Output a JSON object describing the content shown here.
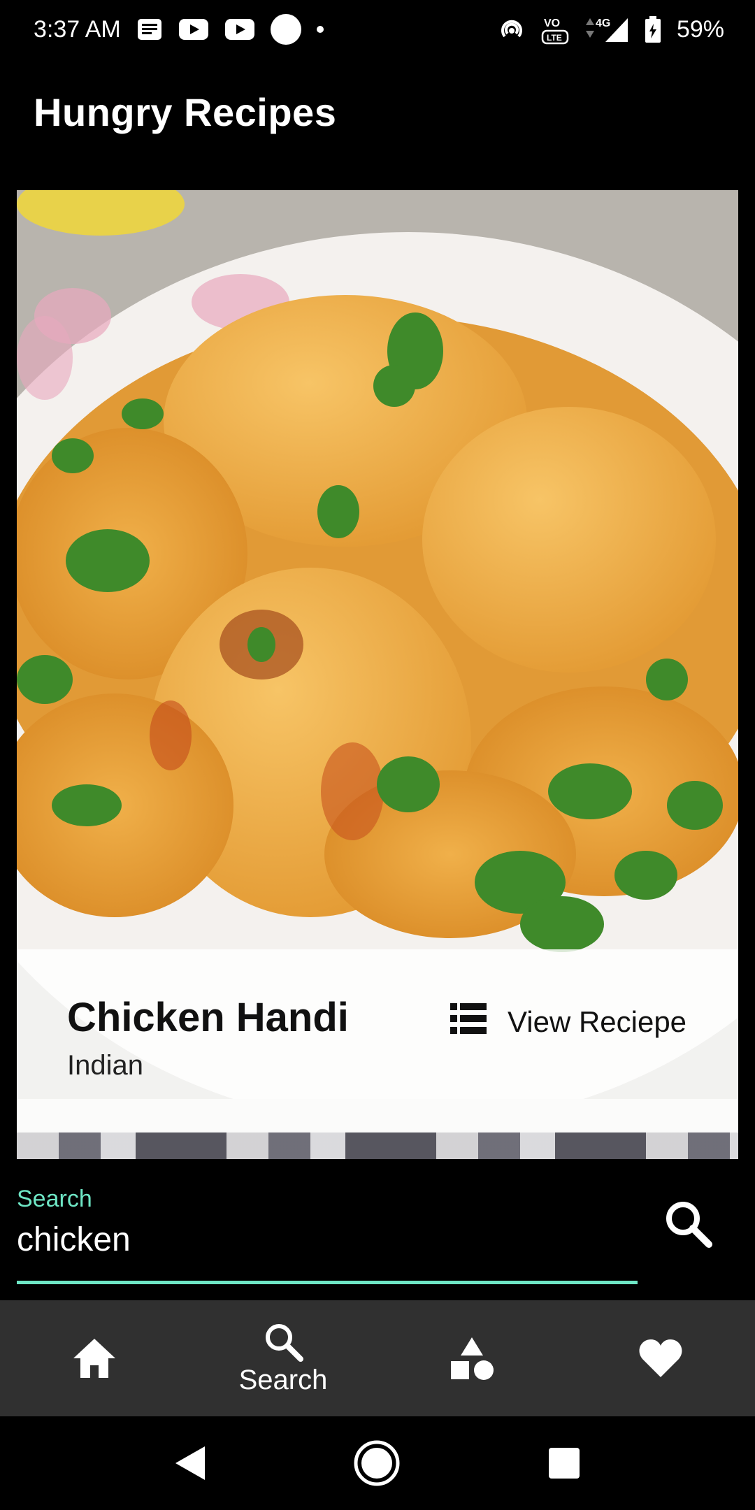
{
  "status_bar": {
    "time": "3:37 AM",
    "network": "4G",
    "battery": "59%",
    "left_icons": [
      "notes-icon",
      "youtube-icon",
      "youtube-icon",
      "circle-icon",
      "dot-icon"
    ],
    "right_icons": [
      "hotspot-icon",
      "volte-icon",
      "signal-icon",
      "battery-charging-icon"
    ]
  },
  "app_bar": {
    "title": "Hungry Recipes"
  },
  "featured_recipe": {
    "name": "Chicken Handi",
    "cuisine": "Indian",
    "view_label": "View Reciepe",
    "view_icon": "list-icon",
    "image_icon": "recipe-photo"
  },
  "search": {
    "label": "Search",
    "value": "chicken",
    "button_icon": "search-icon",
    "accent_color": "#6ee6c5"
  },
  "bottom_nav": {
    "items": [
      {
        "icon": "home-icon",
        "label": ""
      },
      {
        "icon": "search-icon",
        "label": "Search"
      },
      {
        "icon": "categories-icon",
        "label": ""
      },
      {
        "icon": "heart-icon",
        "label": ""
      }
    ],
    "background": "#303030"
  },
  "system_nav": {
    "buttons": [
      "back-icon",
      "home-circle-icon",
      "recents-icon"
    ]
  }
}
